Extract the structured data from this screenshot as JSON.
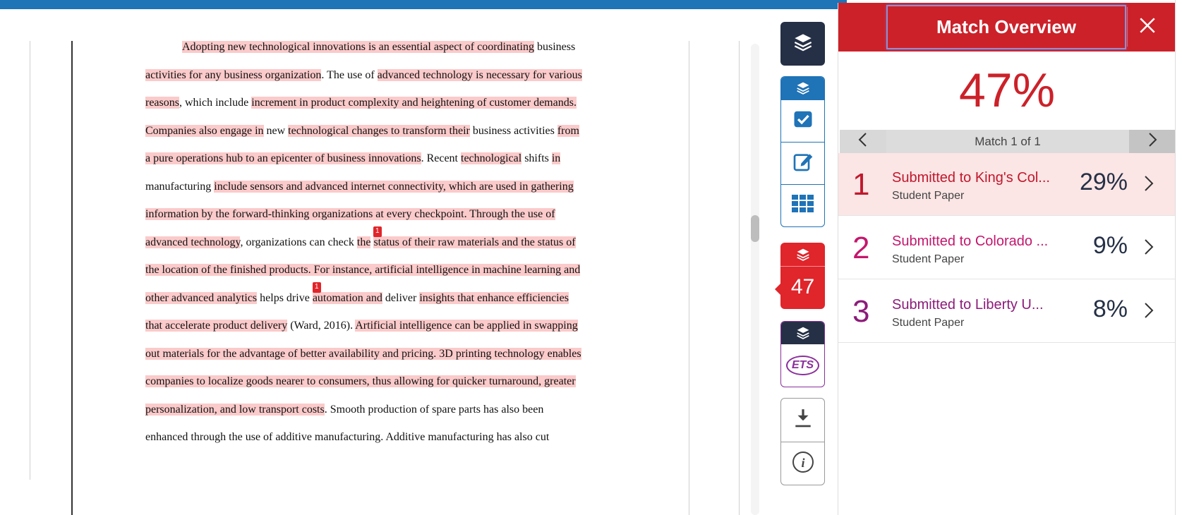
{
  "document": {
    "lines": [
      [
        {
          "t": "Adopting new technological innovations is an essential aspect of coordinating",
          "h": true
        },
        {
          "t": " business",
          "h": false
        }
      ],
      [
        {
          "t": "activities for any business organization",
          "h": true
        },
        {
          "t": ". The use of ",
          "h": false
        },
        {
          "t": "advanced technology is necessary for various",
          "h": true
        }
      ],
      [
        {
          "t": "reasons",
          "h": true
        },
        {
          "t": ", which include ",
          "h": false
        },
        {
          "t": "increment in product complexity and heightening of customer demands.",
          "h": true
        }
      ],
      [
        {
          "t": "Companies also engage in",
          "h": true
        },
        {
          "t": " new ",
          "h": false
        },
        {
          "t": "technological changes to transform their",
          "h": true
        },
        {
          "t": " business activities ",
          "h": false
        },
        {
          "t": "from",
          "h": true
        }
      ],
      [
        {
          "t": "a pure operations hub to an epicenter of business innovations",
          "h": true
        },
        {
          "t": ". Recent ",
          "h": false
        },
        {
          "t": "technological",
          "h": true
        },
        {
          "t": " shifts ",
          "h": false
        },
        {
          "t": "in",
          "h": true
        }
      ],
      [
        {
          "t": "manufacturing ",
          "h": false
        },
        {
          "t": "include sensors and advanced internet connectivity, which are used in gathering",
          "h": true
        }
      ],
      [
        {
          "t": "information by the forward-thinking organizations at every checkpoint. Through the use of",
          "h": true
        }
      ],
      [
        {
          "t": "advanced technology",
          "h": true
        },
        {
          "t": ", organizations can check ",
          "h": false
        },
        {
          "t": "the",
          "h": true
        },
        {
          "t": " ",
          "h": false
        },
        {
          "t": "status of their raw materials and the status of",
          "h": true
        }
      ],
      [
        {
          "t": "the location of the finished products. For instance, artificial intelligence in machine learning and",
          "h": true
        }
      ],
      [
        {
          "t": "other advanced analytics",
          "h": true
        },
        {
          "t": " helps drive ",
          "h": false
        },
        {
          "t": "automation and",
          "h": true
        },
        {
          "t": " deliver ",
          "h": false
        },
        {
          "t": "insights that enhance efficiencies",
          "h": true
        }
      ],
      [
        {
          "t": "that accelerate product delivery",
          "h": true
        },
        {
          "t": " (Ward, 2016). ",
          "h": false
        },
        {
          "t": "Artificial intelligence can be applied in swapping",
          "h": true
        }
      ],
      [
        {
          "t": "out materials for the advantage of better availability and pricing. 3D printing technology enables",
          "h": true
        }
      ],
      [
        {
          "t": "companies to localize goods nearer to consumers, thus allowing for quicker turnaround, greater",
          "h": true
        }
      ],
      [
        {
          "t": "personalization, and low transport costs",
          "h": true
        },
        {
          "t": ". Smooth production of spare parts has also been",
          "h": false
        }
      ],
      [
        {
          "t": "enhanced through the use of additive manufacturing. Additive manufacturing has also cut",
          "h": false
        }
      ]
    ],
    "markers": [
      {
        "label": "1",
        "line": 7
      },
      {
        "label": "1",
        "line": 9
      }
    ]
  },
  "rail": {
    "match_count": "47",
    "ets_label": "ETS"
  },
  "panel": {
    "title": "Match Overview",
    "percentage": "47%",
    "pager_label": "Match 1 of 1",
    "matches": [
      {
        "rank": "1",
        "source": "Submitted to King's Col...",
        "type": "Student Paper",
        "percent": "29%",
        "color": "#c0182c"
      },
      {
        "rank": "2",
        "source": "Submitted to Colorado ...",
        "type": "Student Paper",
        "percent": "9%",
        "color": "#c4176c"
      },
      {
        "rank": "3",
        "source": "Submitted to Liberty U...",
        "type": "Student Paper",
        "percent": "8%",
        "color": "#8c1b7a"
      }
    ]
  },
  "colors": {
    "accent_blue": "#1f73b7",
    "brand_red": "#cc2129",
    "highlight": "#fbcaca",
    "rail_dark": "#253046"
  }
}
